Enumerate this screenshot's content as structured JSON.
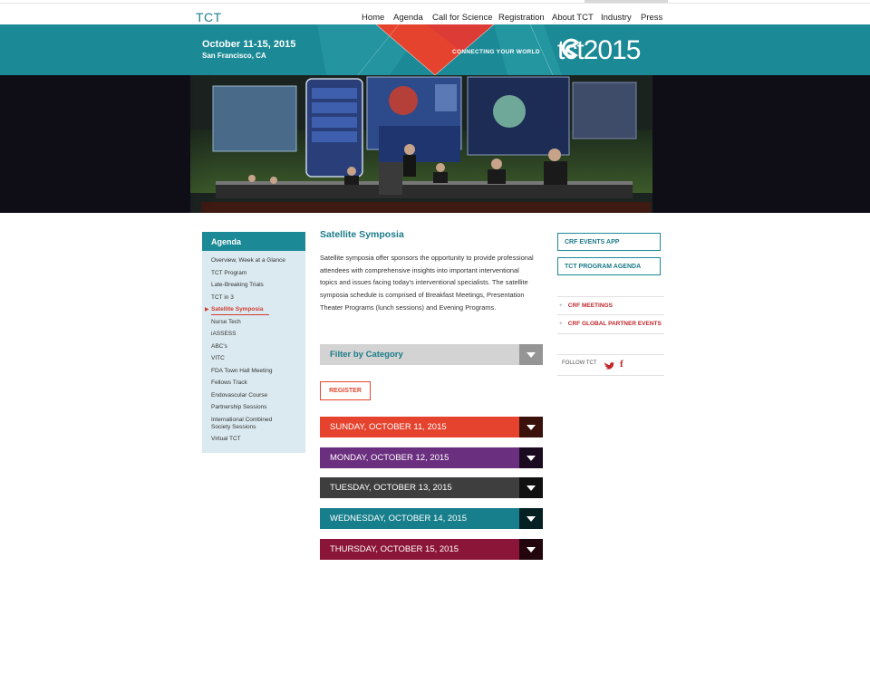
{
  "brand": {
    "logo_text": "TCT"
  },
  "nav": {
    "items": [
      {
        "label": "Home"
      },
      {
        "label": "Agenda"
      },
      {
        "label": "Call for Science"
      },
      {
        "label": "Registration"
      },
      {
        "label": "About TCT"
      },
      {
        "label": "Industry"
      },
      {
        "label": "Press"
      }
    ]
  },
  "banner": {
    "dates": "October 11-15, 2015",
    "location": "San Francisco, CA",
    "tagline": "CONNECTING YOUR WORLD",
    "brand_text": "tct2015",
    "brand_icon": "tct-swirl-icon"
  },
  "sidebar": {
    "heading": "Agenda",
    "items": [
      {
        "label": "Overview, Week at a Glance"
      },
      {
        "label": "TCT Program"
      },
      {
        "label": "Late-Breaking Trials"
      },
      {
        "label": "TCT in 3"
      },
      {
        "label": "Satellite Symposia",
        "active": true
      },
      {
        "label": "Nurse Tech"
      },
      {
        "label": "iASSESS"
      },
      {
        "label": "ABC's"
      },
      {
        "label": "VITC"
      },
      {
        "label": "FDA Town Hall Meeting"
      },
      {
        "label": "Fellows Track"
      },
      {
        "label": "Endovascular Course"
      },
      {
        "label": "Partnership Sessions"
      },
      {
        "label": "International Combined Society Sessions"
      },
      {
        "label": "Virtual TCT"
      }
    ]
  },
  "main": {
    "title": "Satellite Symposia",
    "description": "Satellite symposia offer sponsors the opportunity to provide professional attendees with comprehensive insights into important interventional topics and issues facing today's interventional specialists. The satellite symposia schedule is comprised of Breakfast Meetings, Presentation Theater Programs (lunch sessions) and Evening Programs.",
    "filter_label": "Filter by Category",
    "register_label": "REGISTER",
    "days": [
      {
        "label": "SUNDAY, OCTOBER 11, 2015",
        "color": "#e5432e"
      },
      {
        "label": "MONDAY, OCTOBER 12, 2015",
        "color": "#6b2f7f"
      },
      {
        "label": "TUESDAY, OCTOBER 13, 2015",
        "color": "#3e3e3e"
      },
      {
        "label": "WEDNESDAY, OCTOBER 14, 2015",
        "color": "#177f8c"
      },
      {
        "label": "THURSDAY, OCTOBER 15, 2015",
        "color": "#8b1538"
      }
    ]
  },
  "right": {
    "app_button": "CRF EVENTS APP",
    "agenda_button": "TCT PROGRAM AGENDA",
    "links": [
      {
        "label": "CRF MEETINGS"
      },
      {
        "label": "CRF GLOBAL PARTNER EVENTS"
      }
    ],
    "follow_label": "FOLLOW TCT",
    "social_icons": [
      "twitter-icon",
      "facebook-icon"
    ]
  },
  "colors": {
    "teal": "#1b8a96",
    "red": "#e5432e",
    "sidebar_bg": "#dbeaf0"
  }
}
